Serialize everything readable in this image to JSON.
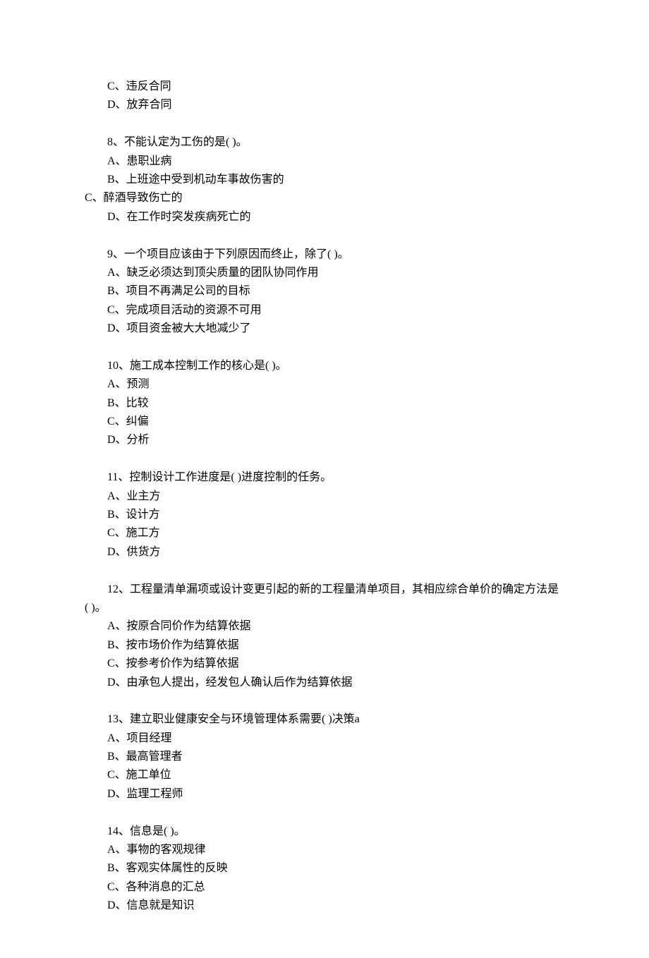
{
  "q7_tail": {
    "option_c": "C、违反合同",
    "option_d": "D、放弃合同"
  },
  "q8": {
    "stem": "8、不能认定为工伤的是( )。",
    "option_a": "A、患职业病",
    "option_b": "B、上班途中受到机动车事故伤害的",
    "option_c": "C、醉酒导致伤亡的",
    "option_d": "D、在工作时突发疾病死亡的"
  },
  "q9": {
    "stem": "9、一个项目应该由于下列原因而终止，除了( )。",
    "option_a": "A、缺乏必须达到顶尖质量的团队协同作用",
    "option_b": "B、项目不再满足公司的目标",
    "option_c": "C、完成项目活动的资源不可用",
    "option_d": "D、项目资金被大大地减少了"
  },
  "q10": {
    "stem": "10、施工成本控制工作的核心是( )。",
    "option_a": "A、预测",
    "option_b": "B、比较",
    "option_c": "C、纠偏",
    "option_d": "D、分析"
  },
  "q11": {
    "stem": "11、控制设计工作进度是( )进度控制的任务。",
    "option_a": "A、业主方",
    "option_b": "B、设计方",
    "option_c": "C、施工方",
    "option_d": "D、供货方"
  },
  "q12": {
    "stem": "12、工程量清单漏项或设计变更引起的新的工程量清单项目，其相应综合单价的确定方法是 ( )。",
    "option_a": "A、按原合同价作为结算依据",
    "option_b": "B、按市场价作为结算依据",
    "option_c": "C、按参考价作为结算依据",
    "option_d": "D、由承包人提出，经发包人确认后作为结算依据"
  },
  "q13": {
    "stem": "13、建立职业健康安全与环境管理体系需要( )决策a",
    "option_a": "A、项目经理",
    "option_b": "B、最高管理者",
    "option_c": "C、施工单位",
    "option_d": "D、监理工程师"
  },
  "q14": {
    "stem": "14、信息是( )。",
    "option_a": "A、事物的客观规律",
    "option_b": "B、客观实体属性的反映",
    "option_c": "C、各种消息的汇总",
    "option_d": "D、信息就是知识"
  }
}
